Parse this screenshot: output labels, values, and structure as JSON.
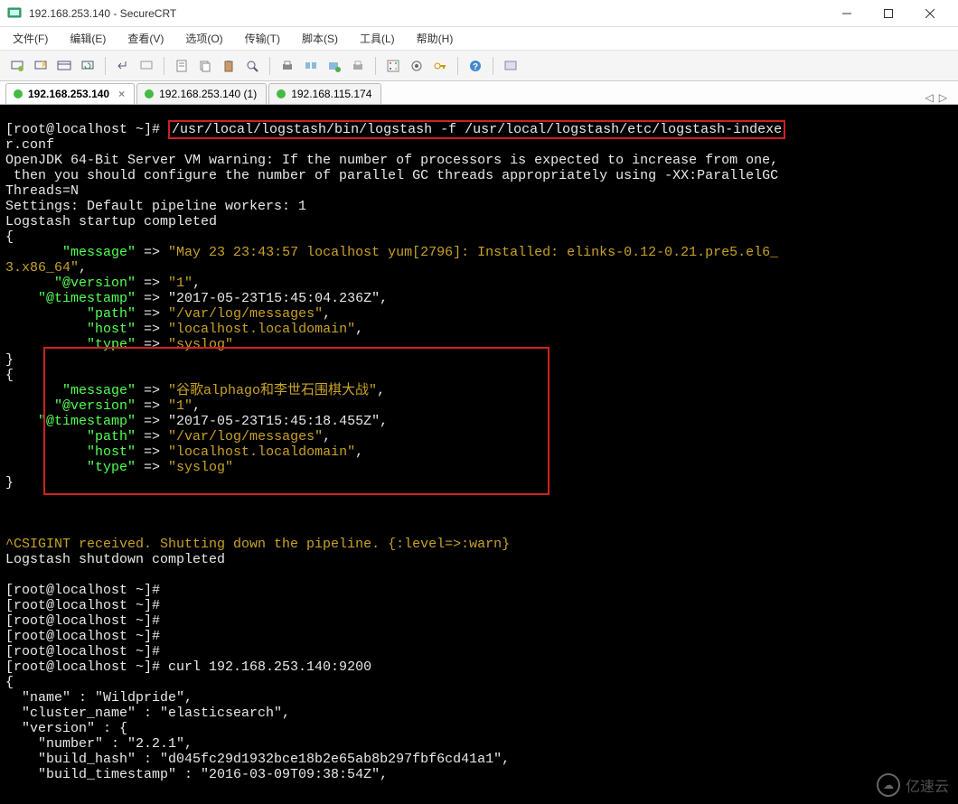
{
  "window": {
    "title": "192.168.253.140 - SecureCRT"
  },
  "menubar": {
    "file": "文件(F)",
    "edit": "编辑(E)",
    "view": "查看(V)",
    "options": "选项(O)",
    "transfer": "传输(T)",
    "script": "脚本(S)",
    "tools": "工具(L)",
    "help": "帮助(H)"
  },
  "tabs": {
    "t1": "192.168.253.140",
    "t2": "192.168.253.140 (1)",
    "t3": "192.168.115.174"
  },
  "term": {
    "prompt1": "[root@localhost ~]# ",
    "cmd1": "/usr/local/logstash/bin/logstash -f /usr/local/logstash/etc/logstash-indexe",
    "cmd1b": "r.conf",
    "l_warn1": "OpenJDK 64-Bit Server VM warning: If the number of processors is expected to increase from one,",
    "l_warn2": " then you should configure the number of parallel GC threads appropriately using -XX:ParallelGC",
    "l_warn3": "Threads=N",
    "l_settings": "Settings: Default pipeline workers: 1",
    "l_startup": "Logstash startup completed",
    "brace_open": "{",
    "brace_close": "}",
    "k_msg": "       \"message\"",
    "k_ver": "      \"@version\"",
    "k_ts": "    \"@timestamp\"",
    "k_path": "          \"path\"",
    "k_host": "          \"host\"",
    "k_type": "          \"type\"",
    "arrow": " => ",
    "v1_msg_a": "\"May 23 23:43:57 localhost yum[2796]: Installed: elinks-0.12-0.21.pre5.el6_",
    "v1_msg_b": "3.x86_64\"",
    "v1_ver": "\"1\"",
    "v1_ts": "\"2017-05-23T15:45:04.236Z\"",
    "v1_path": "\"/var/log/messages\"",
    "v1_host": "\"localhost.localdomain\"",
    "v1_type": "\"syslog\"",
    "v2_msg": "\"谷歌alphago和李世石围棋大战\"",
    "v2_ver": "\"1\"",
    "v2_ts": "\"2017-05-23T15:45:18.455Z\"",
    "v2_path": "\"/var/log/messages\"",
    "v2_host": "\"localhost.localdomain\"",
    "v2_type": "\"syslog\"",
    "comma": ",",
    "blank": "",
    "sigint": "^CSIGINT received. Shutting down the pipeline. {:level=>:warn}",
    "shutdown": "Logstash shutdown completed",
    "prompt_empty": "[root@localhost ~]#",
    "cmd_curl": "curl 192.168.253.140:9200",
    "es_name": "  \"name\" : \"Wildpride\",",
    "es_cluster": "  \"cluster_name\" : \"elasticsearch\",",
    "es_ver": "  \"version\" : {",
    "es_num": "    \"number\" : \"2.2.1\",",
    "es_hash": "    \"build_hash\" : \"d045fc29d1932bce18b2e65ab8b297fbf6cd41a1\",",
    "es_bts": "    \"build_timestamp\" : \"2016-03-09T09:38:54Z\","
  },
  "watermark": "亿速云"
}
